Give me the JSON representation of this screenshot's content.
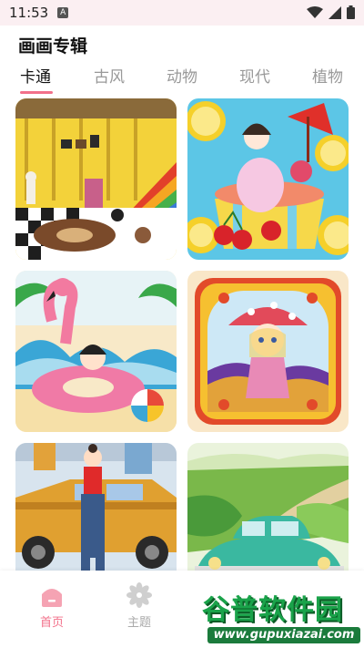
{
  "status_bar": {
    "time": "11:53",
    "notification_glyph": "A"
  },
  "header": {
    "title": "画画专辑"
  },
  "tabs": [
    {
      "label": "卡通",
      "active": true
    },
    {
      "label": "古风",
      "active": false
    },
    {
      "label": "动物",
      "active": false
    },
    {
      "label": "现代",
      "active": false
    },
    {
      "label": "植物",
      "active": false
    }
  ],
  "gallery": {
    "cards": [
      {
        "name": "cartoon-room-artwork"
      },
      {
        "name": "lemon-girl-artwork"
      },
      {
        "name": "flamingo-beach-artwork"
      },
      {
        "name": "mushroom-girl-artwork"
      },
      {
        "name": "taxi-girl-artwork"
      },
      {
        "name": "vintage-car-artwork"
      }
    ]
  },
  "tab_bar": {
    "home_label": "首页",
    "theme_label": "主题"
  },
  "watermark": {
    "title": "谷普软件园",
    "url": "www.gupuxiazai.com"
  },
  "colors": {
    "accent": "#f2708a",
    "status_bg": "#fbeff2",
    "watermark_green": "#1aa34a"
  }
}
